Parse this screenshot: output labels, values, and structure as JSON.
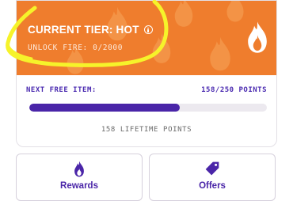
{
  "tier": {
    "title": "CURRENT TIER: HOT",
    "unlock_text": "UNLOCK FIRE: 0/2000",
    "icon": "flame-icon",
    "info_icon": "info-icon"
  },
  "progress": {
    "next_label": "NEXT FREE ITEM:",
    "points_label": "158/250 POINTS",
    "current": 158,
    "goal": 250,
    "lifetime_label": "158 LIFETIME POINTS"
  },
  "tiles": [
    {
      "label": "Rewards",
      "icon": "flame-icon"
    },
    {
      "label": "Offers",
      "icon": "tag-icon"
    }
  ],
  "colors": {
    "banner": "#ef7d2d",
    "accent": "#4a25a8",
    "highlight": "#f6f32a"
  }
}
